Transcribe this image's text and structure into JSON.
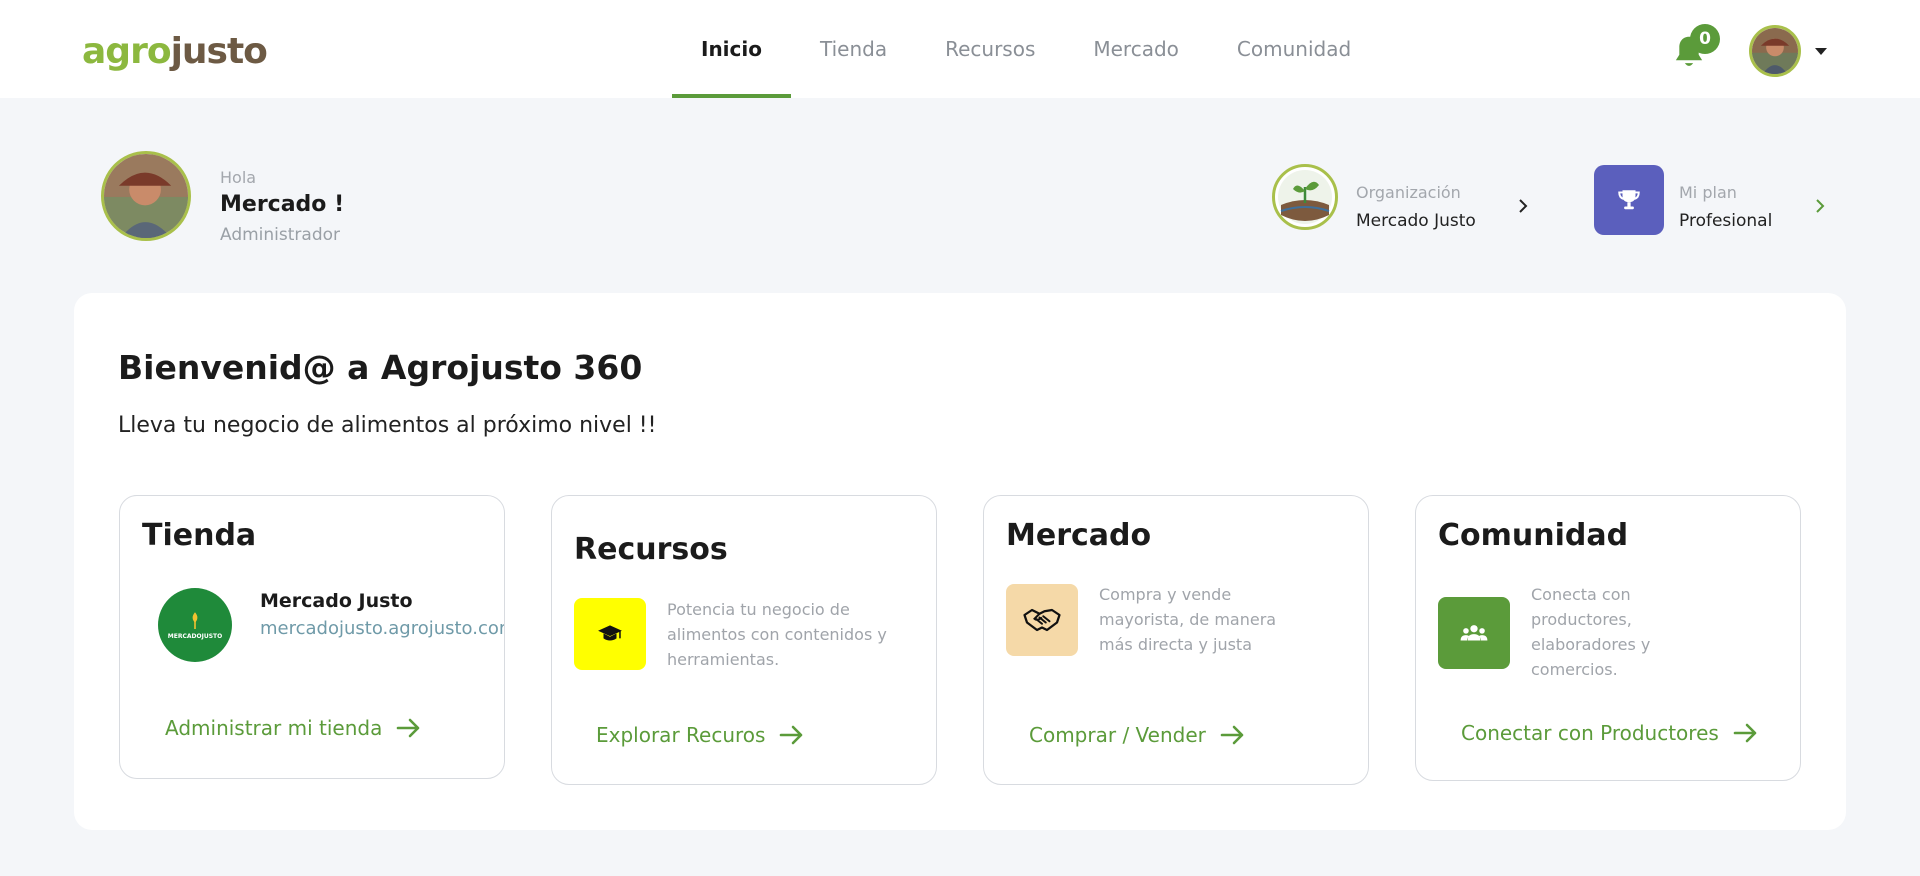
{
  "brand": {
    "logo_part1": "agro",
    "logo_part2": "justo",
    "color_green": "#8cb83f",
    "color_brown": "#6d5a44"
  },
  "nav": {
    "tabs": [
      {
        "label": "Inicio",
        "active": true
      },
      {
        "label": "Tienda",
        "active": false
      },
      {
        "label": "Recursos",
        "active": false
      },
      {
        "label": "Mercado",
        "active": false
      },
      {
        "label": "Comunidad",
        "active": false
      }
    ]
  },
  "header": {
    "notifications_count": "0",
    "bell_icon": "bell-icon",
    "avatar_icon": "avatar"
  },
  "user": {
    "greeting": "Hola",
    "name": "Mercado !",
    "role": "Administrador"
  },
  "organization": {
    "label": "Organización",
    "value": "Mercado Justo"
  },
  "plan": {
    "label": "Mi plan",
    "value": "Profesional",
    "icon": "trophy-icon",
    "color": "#5b5fbd"
  },
  "welcome": {
    "title": "Bienvenid@ a Agrojusto 360",
    "subtitle": "Lleva tu negocio de alimentos al próximo nivel !!"
  },
  "cards": {
    "tienda": {
      "title": "Tienda",
      "store_name": "Mercado Justo",
      "store_url": "mercadojusto.agrojusto.com",
      "logo_text": "MERCADOJUSTO",
      "link": "Administrar mi tienda"
    },
    "recursos": {
      "title": "Recursos",
      "description": "Potencia tu negocio de alimentos con contenidos y herramientas.",
      "link": "Explorar Recuros",
      "icon": "graduation-cap-icon",
      "icon_bg": "#ffff00"
    },
    "mercado": {
      "title": "Mercado",
      "description": "Compra y vende mayorista, de manera más directa y justa",
      "link": "Comprar / Vender",
      "icon": "handshake-icon",
      "icon_bg": "#f5d9a8"
    },
    "comunidad": {
      "title": "Comunidad",
      "description": "Conecta con productores, elaboradores y comercios.",
      "link": "Conectar con Productores",
      "icon": "users-icon",
      "icon_bg": "#5b9b3a"
    }
  },
  "accent_color": "#5b9b3a"
}
